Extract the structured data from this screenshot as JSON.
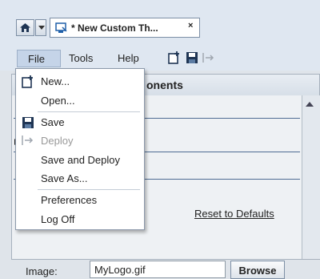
{
  "window": {
    "tab_title": "* New Custom Th...",
    "tab_close": "×"
  },
  "menubar": {
    "file": "File",
    "tools": "Tools",
    "help": "Help"
  },
  "toolbar": {
    "icons": [
      "new-icon",
      "save-icon",
      "deploy-icon"
    ]
  },
  "panel": {
    "title_fragment": "onents"
  },
  "file_menu": {
    "items": [
      {
        "label": "New...",
        "icon": "new-icon",
        "enabled": true
      },
      {
        "label": "Open...",
        "enabled": true
      },
      {
        "label": "Save",
        "icon": "save-icon",
        "enabled": true
      },
      {
        "label": "Deploy",
        "icon": "deploy-icon",
        "enabled": false
      },
      {
        "label": "Save and Deploy",
        "enabled": true
      },
      {
        "label": "Save As...",
        "enabled": true
      },
      {
        "label": "Preferences",
        "enabled": true
      },
      {
        "label": "Log Off",
        "enabled": true
      }
    ]
  },
  "content": {
    "reset_link": "Reset to Defaults",
    "image_label": "Image:",
    "image_value": "MyLogo.gif",
    "browse": "Browse"
  },
  "colors": {
    "header_bg": "#dfe7f1",
    "menu_highlight": "#c5d4e8",
    "accent": "#1f5fa8"
  }
}
